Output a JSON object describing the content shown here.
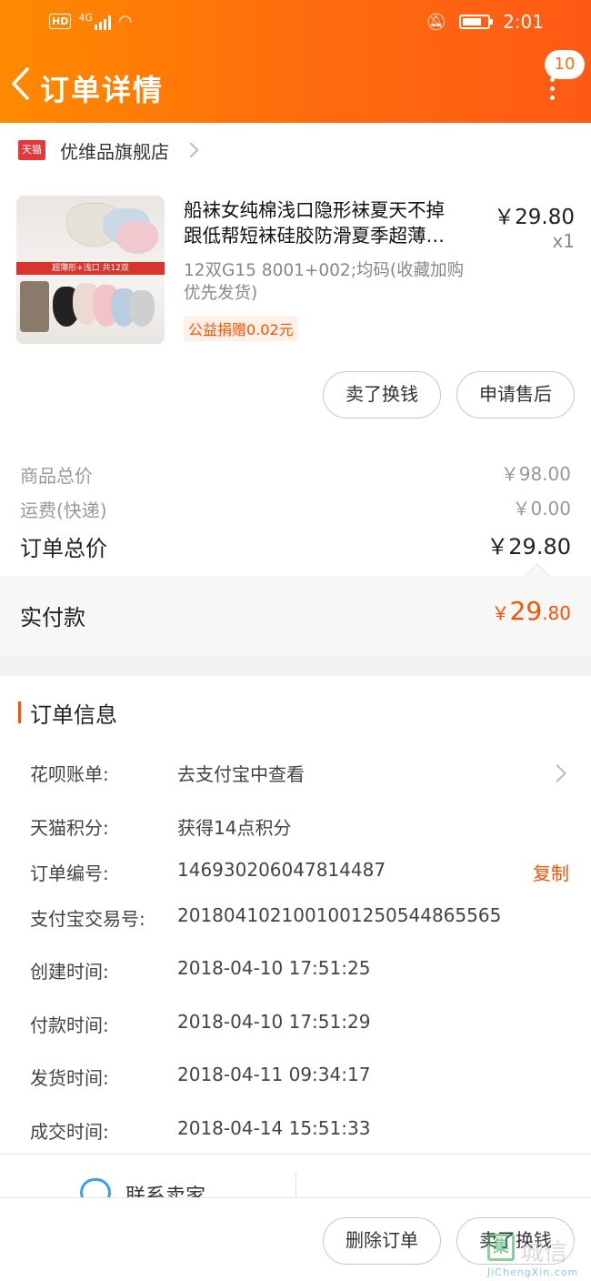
{
  "status_bar": {
    "hd": "HD",
    "network": "4G",
    "time": "2:01"
  },
  "nav": {
    "title": "订单详情",
    "message_count": "10"
  },
  "shop": {
    "logo_text": "天猫",
    "name": "优维品旗舰店"
  },
  "product": {
    "title_line1": "船袜女纯棉浅口隐形袜夏天不掉",
    "title_line2": "跟低帮短袜硅胶防滑夏季超薄…",
    "price": "￥29.80",
    "quantity": "x1",
    "spec_line1": "12双G15 8001+002;均码(收藏加购",
    "spec_line2": "优先发货)",
    "charity": "公益捐赠0.02元",
    "image_banner": "超薄形+浅口  共12双",
    "actions": {
      "resell": "卖了换钱",
      "after_sale": "申请售后"
    }
  },
  "prices": {
    "goods_total_label": "商品总价",
    "goods_total_value": "￥98.00",
    "shipping_label": "运费(快递)",
    "shipping_value": "￥0.00",
    "order_total_label": "订单总价",
    "order_total_value": "￥29.80",
    "paid_label": "实付款",
    "paid_currency": "￥",
    "paid_int": "29",
    "paid_dec": ".80"
  },
  "order_info": {
    "heading": "订单信息",
    "rows": [
      {
        "label": "花呗账单:",
        "value": "去支付宝中查看"
      },
      {
        "label": "天猫积分:",
        "value": "获得14点积分"
      },
      {
        "label": "订单编号:",
        "value": "146930206047814487",
        "action": "复制"
      },
      {
        "label": "支付宝交易号:",
        "value": "2018041021001001250544865565"
      },
      {
        "label": "创建时间:",
        "value": "2018-04-10 17:51:25"
      },
      {
        "label": "付款时间:",
        "value": "2018-04-10 17:51:29"
      },
      {
        "label": "发货时间:",
        "value": "2018-04-11 09:34:17"
      },
      {
        "label": "成交时间:",
        "value": "2018-04-14 15:51:33"
      }
    ]
  },
  "contact": {
    "label": "联系卖家"
  },
  "bottom_actions": {
    "delete": "删除订单",
    "resell": "卖了换钱"
  },
  "watermark": {
    "mark": "集",
    "text": "城信",
    "sub": "JiChengXin.com"
  },
  "colors": {
    "header_start": "#ff8a00",
    "header_end": "#ff5a14",
    "accent": "#ff5000",
    "tmall_red": "#e4393c"
  }
}
